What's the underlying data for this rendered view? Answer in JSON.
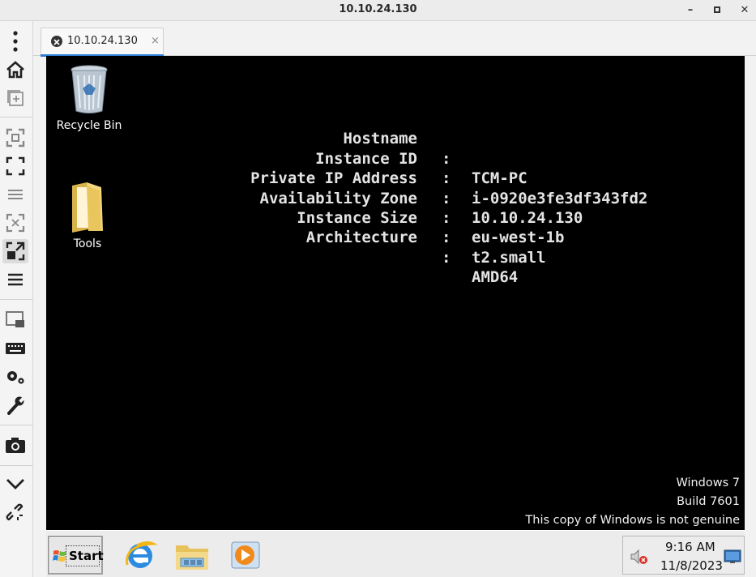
{
  "window": {
    "title": "10.10.24.130",
    "minimize_glyph": "–",
    "close_glyph": "✕"
  },
  "tabs": [
    {
      "label": "10.10.24.130",
      "close_glyph": "×",
      "active": true
    }
  ],
  "sidebar": {
    "buttons": [
      "menu-dots-icon",
      "home-icon",
      "new-window-icon",
      "fit-screen-icon",
      "fullscreen-icon",
      "list-icon",
      "scale-icon",
      "stretch-icon",
      "hamburger-icon",
      "display-icon",
      "keyboard-icon",
      "settings-icon",
      "wrench-icon",
      "camera-icon",
      "chevron-down-icon",
      "disconnect-icon"
    ],
    "active": "stretch-icon"
  },
  "desktop": {
    "icons": [
      {
        "label": "Recycle Bin",
        "icon": "recycle-bin-icon"
      },
      {
        "label": "Tools",
        "icon": "folder-icon"
      }
    ],
    "sysinfo": [
      {
        "label": "Hostname",
        "value": "TCM-PC"
      },
      {
        "label": "Instance ID",
        "value": "i-0920e3fe3df343fd2"
      },
      {
        "label": "Private IP Address",
        "value": "10.10.24.130"
      },
      {
        "label": "Availability Zone",
        "value": "eu-west-1b"
      },
      {
        "label": "Instance Size",
        "value": "t2.small"
      },
      {
        "label": "Architecture",
        "value": "AMD64"
      }
    ],
    "separator": ":",
    "watermark": {
      "line1": "Windows 7",
      "line2": "Build 7601",
      "line3": "This copy of Windows is not genuine"
    }
  },
  "taskbar": {
    "start_label": "Start",
    "apps": [
      "internet-explorer-icon",
      "file-explorer-icon",
      "media-player-icon"
    ],
    "tray": {
      "time": "9:16 AM",
      "date": "11/8/2023",
      "icons": [
        "volume-muted-icon",
        "show-desktop-icon"
      ]
    }
  },
  "colors": {
    "accent": "#2a7fd4",
    "desktop_bg": "#000000",
    "taskbar_bg": "#ececec"
  }
}
